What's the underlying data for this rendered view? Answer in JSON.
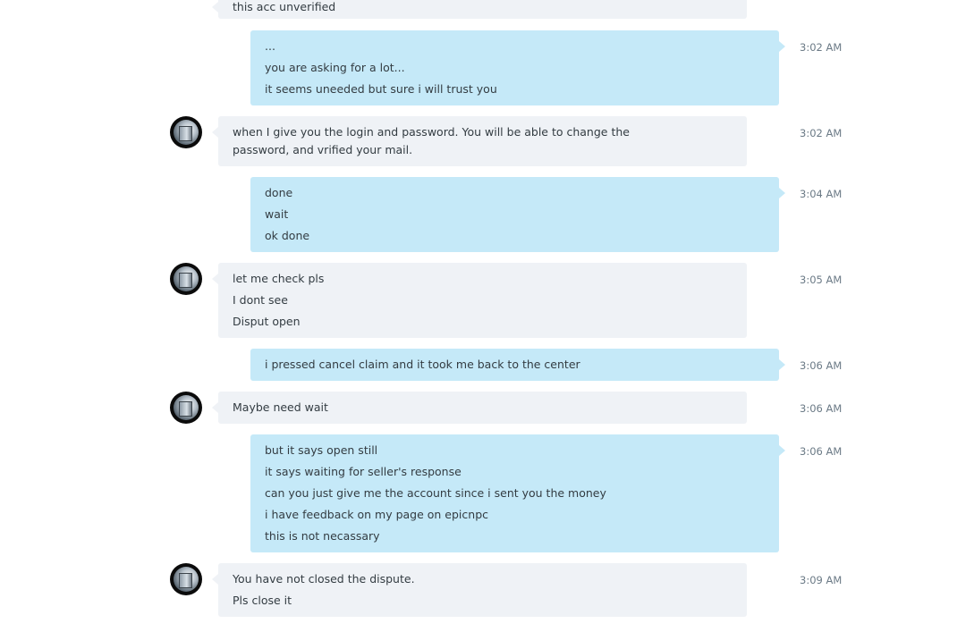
{
  "messages": [
    {
      "id": "m0",
      "side": "in",
      "lines": [
        "this acc unverified"
      ],
      "time": ""
    },
    {
      "id": "m1",
      "side": "out",
      "lines": [
        "...",
        "you are asking for a lot...",
        "it seems uneeded but sure i will trust you"
      ],
      "time": "3:02 AM"
    },
    {
      "id": "m2",
      "side": "in",
      "lines": [
        "when I give you the login and password. You will be able to change the password, and vrified your mail."
      ],
      "time": "3:02 AM"
    },
    {
      "id": "m3",
      "side": "out",
      "lines": [
        "done",
        "wait",
        "ok done"
      ],
      "time": "3:04 AM"
    },
    {
      "id": "m4",
      "side": "in",
      "lines": [
        "let me check pls",
        "I dont see",
        "Disput open"
      ],
      "time": "3:05 AM"
    },
    {
      "id": "m5",
      "side": "out",
      "lines": [
        "i pressed cancel claim and it took me back to the center"
      ],
      "time": "3:06 AM"
    },
    {
      "id": "m6",
      "side": "in",
      "lines": [
        "Maybe need wait"
      ],
      "time": "3:06 AM"
    },
    {
      "id": "m7",
      "side": "out",
      "lines": [
        "but it says open still",
        "it says waiting for seller's response",
        "can you just give me the account since i sent you the money",
        "i have feedback on my page on epicnpc",
        "this is not necassary"
      ],
      "time": "3:06 AM"
    },
    {
      "id": "m8",
      "side": "in",
      "lines": [
        "You have not closed the dispute.",
        "Pls close it"
      ],
      "time": "3:09 AM"
    }
  ],
  "colors": {
    "incoming_bubble": "#eff2f6",
    "outgoing_bubble": "#c5e9f8",
    "timestamp": "#6b7a86",
    "text": "#333c42"
  },
  "icons": {
    "avatar": "contact-avatar-icon"
  }
}
